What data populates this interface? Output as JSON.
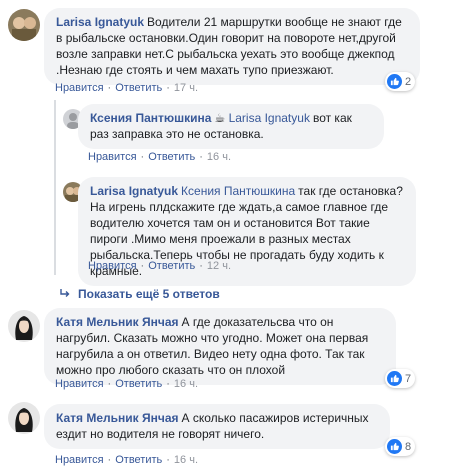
{
  "comments": [
    {
      "author": "Larisa Ignatyuk",
      "text": "Водители 21 маршрутки вообще не знают где в рыбальске остановки.Один говорит на повороте нет,другой возле заправки нет.С рыбальска уехать это вообще джекпод .Незнаю где стоять и чем махать тупо приезжают.",
      "like": "Нравится",
      "reply": "Ответить",
      "time": "17 ч.",
      "reactions": "2"
    },
    {
      "author": "Ксения Пантюшкина",
      "emoji": "☕",
      "mention": "Larisa Ignatyuk",
      "text": "вот как раз заправка это не остановка.",
      "like": "Нравится",
      "reply": "Ответить",
      "time": "16 ч."
    },
    {
      "author": "Larisa Ignatyuk",
      "mention": "Ксения Пантюшкина",
      "text": "так где остановка?На игрень плдскажите где ждать,а самое главное где водителю хочется там он и остановится Вот такие пироги .Мимо меня проежали в разных местах рыбальска.Теперь чтобы не прогадать буду ходить к крамные.",
      "like": "Нравится",
      "reply": "Ответить",
      "time": "12 ч."
    },
    {
      "author": "Катя Мельник Янчая",
      "text": "А где доказательсва что он нагрубил. Сказать можно что угодно. Может она первая нагрубила а он ответил. Видео нету одна фото. Так так можно про любого сказать что он плохой",
      "like": "Нравится",
      "reply": "Ответить",
      "time": "16 ч.",
      "reactions": "7"
    },
    {
      "author": "Катя Мельник Янчая",
      "text": "А сколько пасажиров истеричных ездит но водителя не говорят ничего.",
      "like": "Нравится",
      "reply": "Ответить",
      "time": "16 ч.",
      "reactions": "8"
    }
  ],
  "more_replies": "Показать ещё 5 ответов",
  "colors": {
    "link": "#385898",
    "bubble": "#f2f3f5",
    "like_blue": "#2078f4"
  }
}
